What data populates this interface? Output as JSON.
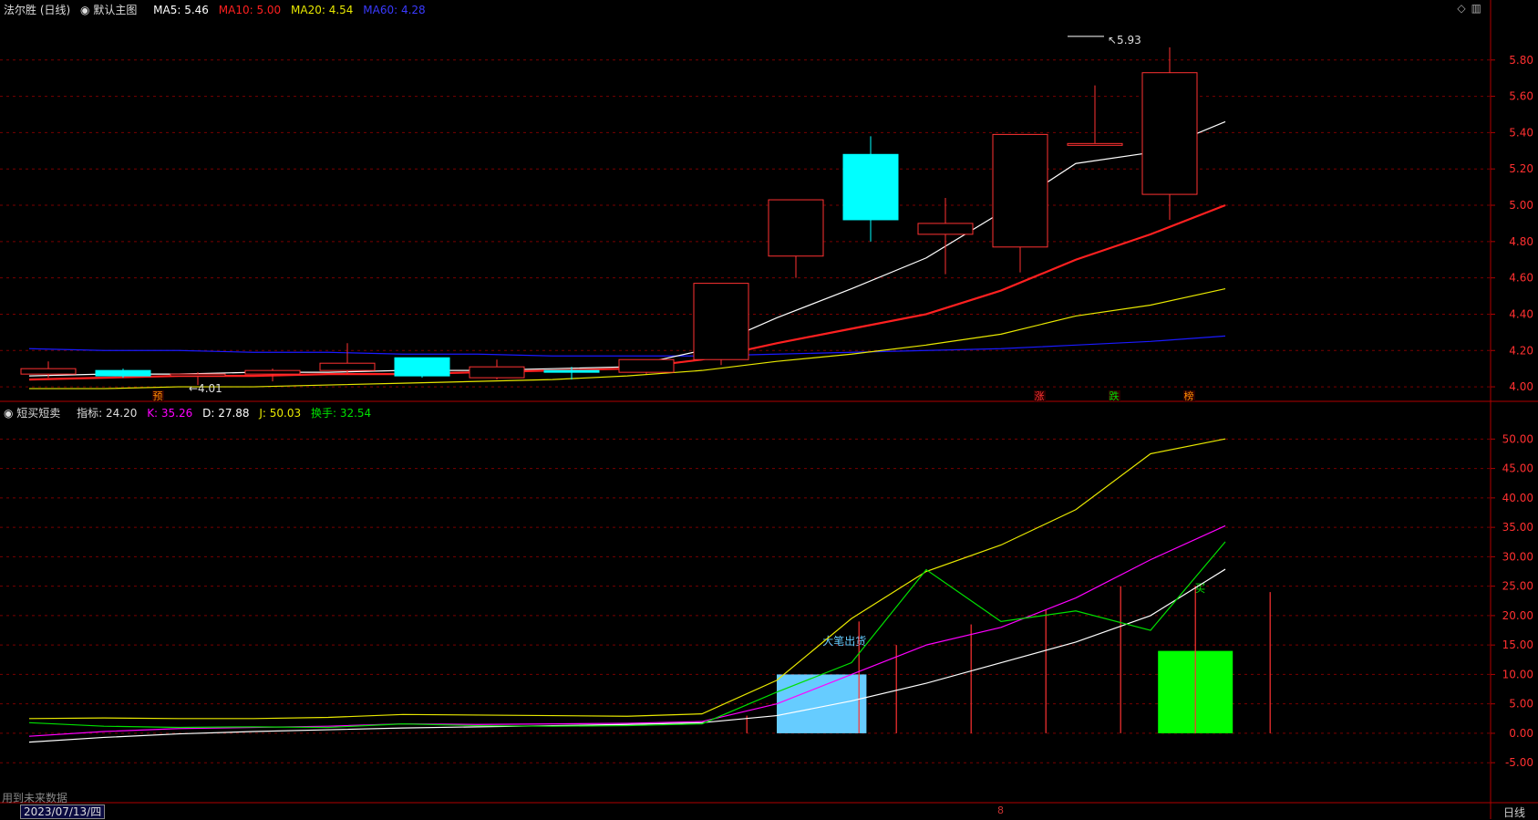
{
  "header_top": {
    "stock": "法尔胜 (日线)",
    "template": "默认主图",
    "ma5": "MA5: 5.46",
    "ma10": "MA10: 5.00",
    "ma20": "MA20: 4.54",
    "ma60": "MA60: 4.28"
  },
  "header_bottom": {
    "indicator": "短买短卖",
    "value": "指标: 24.20",
    "k": "K: 35.26",
    "d": "D: 27.88",
    "j": "J: 50.03",
    "turnover": "换手: 32.54"
  },
  "footer": {
    "future_note": "用到未来数据",
    "date": "2023/07/13/四",
    "period": "日线",
    "x_marker": "8"
  },
  "colors": {
    "background": "#000000",
    "up": "#ff3232",
    "down": "#00ffff",
    "ma5": "#ffffff",
    "ma10": "#ff2020",
    "ma20": "#e8e800",
    "ma60": "#1a1aff",
    "k": "#ff00ff",
    "d": "#ffffff",
    "j": "#e8e800",
    "turnover": "#00e000",
    "grid": "#7a0000",
    "axis": "#b00000"
  },
  "chart_data": [
    {
      "type": "candlestick",
      "ylim": [
        3.92,
        6.04
      ],
      "yticks": [
        "5.80",
        "5.60",
        "5.40",
        "5.20",
        "5.00",
        "4.80",
        "4.60",
        "4.40",
        "4.20",
        "4.00"
      ],
      "candles": [
        {
          "open": 4.07,
          "close": 4.1,
          "high": 4.14,
          "low": 4.05
        },
        {
          "open": 4.09,
          "close": 4.06,
          "high": 4.1,
          "low": 4.05
        },
        {
          "open": 4.06,
          "close": 4.07,
          "high": 4.08,
          "low": 4.01
        },
        {
          "open": 4.07,
          "close": 4.09,
          "high": 4.1,
          "low": 4.03
        },
        {
          "open": 4.09,
          "close": 4.13,
          "high": 4.24,
          "low": 4.07
        },
        {
          "open": 4.16,
          "close": 4.06,
          "high": 4.16,
          "low": 4.05
        },
        {
          "open": 4.05,
          "close": 4.11,
          "high": 4.15,
          "low": 4.04
        },
        {
          "open": 4.09,
          "close": 4.08,
          "high": 4.11,
          "low": 4.04
        },
        {
          "open": 4.08,
          "close": 4.15,
          "high": 4.15,
          "low": 4.07
        },
        {
          "open": 4.15,
          "close": 4.57,
          "high": 4.57,
          "low": 4.12
        },
        {
          "open": 4.72,
          "close": 5.03,
          "high": 5.03,
          "low": 4.6
        },
        {
          "open": 5.28,
          "close": 4.92,
          "high": 5.38,
          "low": 4.8
        },
        {
          "open": 4.84,
          "close": 4.9,
          "high": 5.04,
          "low": 4.62
        },
        {
          "open": 4.77,
          "close": 5.39,
          "high": 5.39,
          "low": 4.63
        },
        {
          "open": 5.33,
          "close": 5.34,
          "high": 5.66,
          "low": 5.33
        },
        {
          "open": 5.06,
          "close": 5.73,
          "high": 5.87,
          "low": 4.92
        }
      ],
      "ma5": [
        4.06,
        4.07,
        4.07,
        4.08,
        4.08,
        4.09,
        4.09,
        4.1,
        4.11,
        4.2,
        4.38,
        4.54,
        4.71,
        4.96,
        5.23,
        5.29,
        5.46
      ],
      "ma10": [
        4.04,
        4.05,
        4.06,
        4.06,
        4.07,
        4.07,
        4.08,
        4.09,
        4.1,
        4.15,
        4.24,
        4.32,
        4.4,
        4.53,
        4.7,
        4.84,
        5.0
      ],
      "ma20": [
        3.99,
        3.99,
        4.0,
        4.0,
        4.01,
        4.02,
        4.03,
        4.04,
        4.06,
        4.09,
        4.14,
        4.18,
        4.23,
        4.29,
        4.39,
        4.45,
        4.54
      ],
      "ma60": [
        4.21,
        4.2,
        4.2,
        4.19,
        4.19,
        4.18,
        4.18,
        4.17,
        4.17,
        4.17,
        4.18,
        4.19,
        4.2,
        4.21,
        4.23,
        4.25,
        4.28
      ],
      "annotations": [
        {
          "text": "5.93",
          "candle": 14,
          "value": 5.93
        },
        {
          "text": "4.01",
          "candle": 2,
          "value": 4.01
        }
      ],
      "markers": [
        {
          "text": "预",
          "candle": 2,
          "color": "#ff8c00"
        },
        {
          "text": "涨",
          "candle": 14,
          "color": "#ff3232"
        },
        {
          "text": "跌",
          "candle": 15,
          "color": "#00e000"
        },
        {
          "text": "榜",
          "candle": 16,
          "color": "#ff8c00"
        }
      ]
    },
    {
      "type": "line",
      "ylim": [
        -9,
        53
      ],
      "yticks": [
        "50.00",
        "45.00",
        "40.00",
        "35.00",
        "30.00",
        "25.00",
        "20.00",
        "15.00",
        "10.00",
        "5.00",
        "0.00",
        "-5.00"
      ],
      "x": [
        0,
        1,
        2,
        3,
        4,
        5,
        6,
        7,
        8,
        9,
        10,
        11,
        12,
        13,
        14,
        15,
        16
      ],
      "series": [
        {
          "name": "J",
          "values": [
            2.5,
            2.6,
            2.5,
            2.5,
            2.7,
            3.2,
            3.1,
            3.0,
            2.9,
            3.3,
            9.0,
            19.5,
            27.5,
            32.0,
            38.0,
            47.5,
            50.03
          ]
        },
        {
          "name": "K",
          "values": [
            -0.5,
            0.3,
            0.8,
            1.0,
            1.2,
            1.6,
            1.5,
            1.6,
            1.7,
            2.0,
            5.0,
            10.0,
            15.0,
            18.0,
            23.0,
            29.5,
            35.26
          ]
        },
        {
          "name": "D",
          "values": [
            -1.5,
            -0.7,
            -0.1,
            0.3,
            0.6,
            0.9,
            1.1,
            1.3,
            1.5,
            1.8,
            3.0,
            5.5,
            8.5,
            12.0,
            15.5,
            20.0,
            27.88
          ]
        },
        {
          "name": "换手",
          "values": [
            1.8,
            1.2,
            1.0,
            1.1,
            1.0,
            1.6,
            1.3,
            1.2,
            1.3,
            1.6,
            7.0,
            12.0,
            27.8,
            19.0,
            20.8,
            17.5,
            32.54
          ]
        }
      ],
      "bars": [
        {
          "from": 10.4,
          "to": 11.6,
          "value": 10,
          "color": "#66ccff",
          "label": "大笔出货"
        },
        {
          "from": 15.5,
          "to": 16.5,
          "value": 14,
          "color": "#00ff00",
          "label": "买"
        }
      ],
      "spikes": [
        {
          "x": 10,
          "value": 3
        },
        {
          "x": 11.5,
          "value": 19
        },
        {
          "x": 12,
          "value": 15
        },
        {
          "x": 13,
          "value": 18.5
        },
        {
          "x": 14,
          "value": 21
        },
        {
          "x": 15,
          "value": 25
        },
        {
          "x": 16,
          "value": 25
        },
        {
          "x": 17,
          "value": 24
        }
      ]
    }
  ]
}
